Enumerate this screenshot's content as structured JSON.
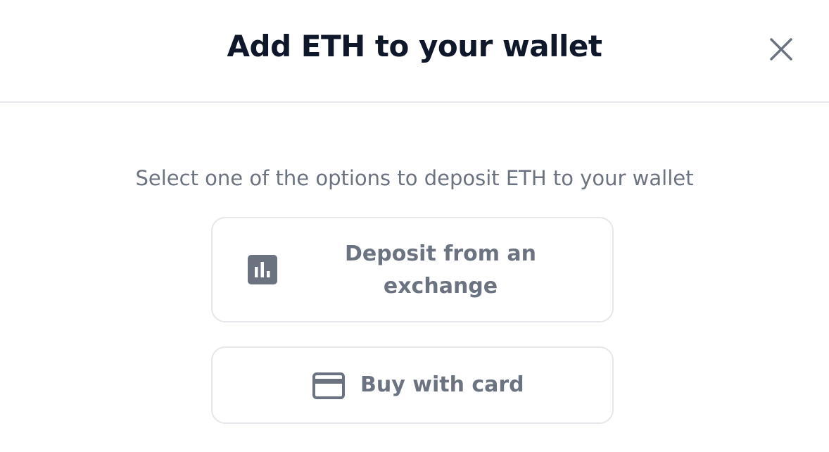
{
  "modal": {
    "title": "Add ETH to your wallet",
    "subtitle": "Select one of the options to deposit ETH to your wallet",
    "close_icon": "close-icon",
    "options": [
      {
        "label": "Deposit from an exchange",
        "icon": "bar-chart-icon"
      },
      {
        "label": "Buy with card",
        "icon": "credit-card-icon"
      }
    ]
  },
  "colors": {
    "title": "#0f172a",
    "muted_text": "#6b7280",
    "border": "#e5e7eb",
    "background": "#ffffff"
  }
}
